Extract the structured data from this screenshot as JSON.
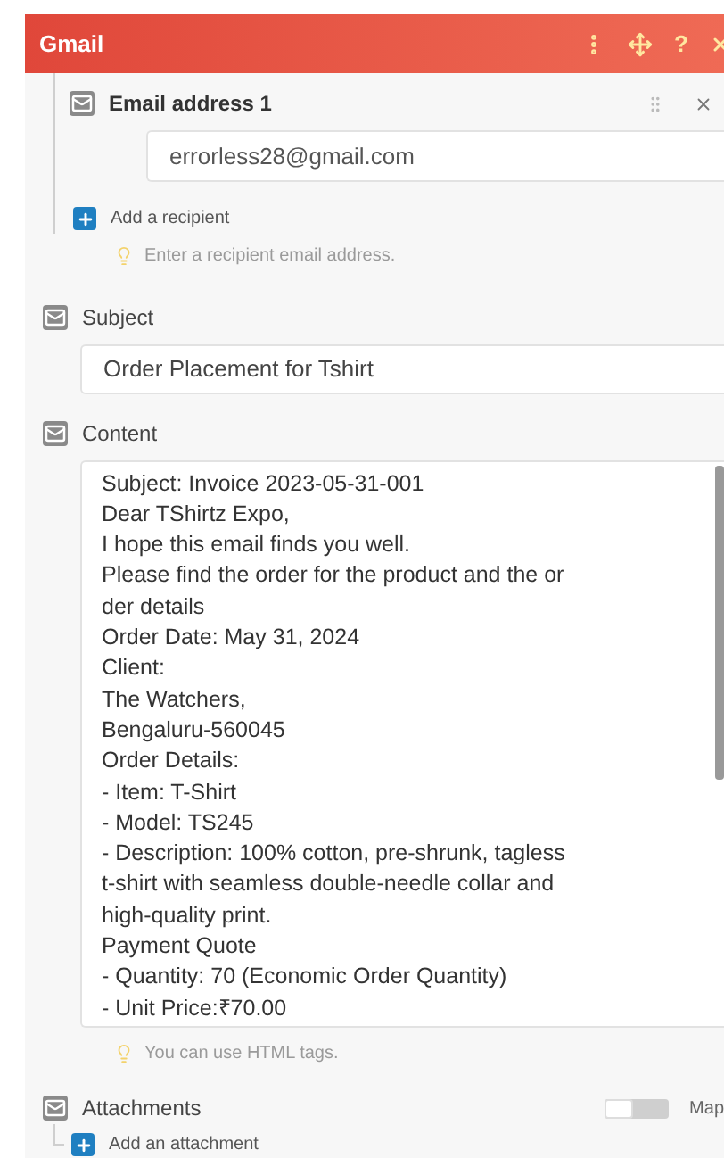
{
  "window": {
    "title": "Gmail",
    "help": "?"
  },
  "recipient": {
    "label": "Email address 1",
    "value": "errorless28@gmail.com",
    "add_label": "Add a recipient",
    "hint": "Enter a recipient email address."
  },
  "subject": {
    "label": "Subject",
    "value": "Order Placement for Tshirt"
  },
  "content": {
    "label": "Content",
    "lines": [
      "Subject: Invoice 2023-05-31-001",
      "Dear TShirtz Expo,",
      "I hope this email finds you well.",
      "Please find the order for the product and the or",
      "der details",
      "Order Date: May 31, 2024",
      "Client:",
      "The Watchers,",
      "Bengaluru-560045",
      "Order Details:",
      "- Item: T-Shirt",
      "- Model: TS245",
      "- Description: 100% cotton, pre-shrunk, tagless",
      "t-shirt with seamless double-needle collar and",
      "high-quality print.",
      "Payment Quote",
      "- Quantity: 70 (Economic Order Quantity)",
      "- Unit Price:₹70.00"
    ],
    "hint": "You can use HTML tags."
  },
  "attachments": {
    "label": "Attachments",
    "map_label": "Map",
    "map_on": false,
    "add_label": "Add an attachment"
  }
}
